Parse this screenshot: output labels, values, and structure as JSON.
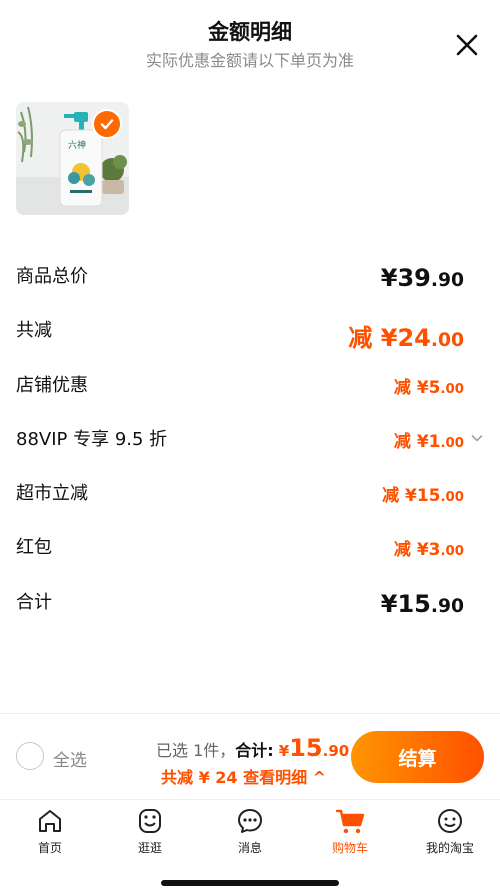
{
  "header": {
    "title": "金额明细",
    "subtitle": "实际优惠金额请以下单页为准"
  },
  "product": {
    "image_alt": "商品图片",
    "selected": true
  },
  "rows": {
    "total": {
      "label": "商品总价",
      "prefix": "¥",
      "int": "39",
      "dec": ".90"
    },
    "discount_total": {
      "label": "共减",
      "prefix": "减 ¥",
      "int": "24",
      "dec": ".00"
    },
    "shop": {
      "label": "店铺优惠",
      "prefix": "减 ¥",
      "int": "5",
      "dec": ".00"
    },
    "vip": {
      "label": "88VIP 专享 9.5 折",
      "prefix": "减 ¥",
      "int": "1",
      "dec": ".00"
    },
    "market": {
      "label": "超市立减",
      "prefix": "减 ¥",
      "int": "15",
      "dec": ".00"
    },
    "redpacket": {
      "label": "红包",
      "prefix": "减 ¥",
      "int": "3",
      "dec": ".00"
    },
    "sum": {
      "label": "合计",
      "prefix": "¥",
      "int": "15",
      "dec": ".90"
    }
  },
  "bottom_bar": {
    "select_all": "全选",
    "selected_count": "已选 1件，",
    "sum_label": "合计:",
    "sum_prefix": "¥",
    "sum_int": "15",
    "sum_dec": ".90",
    "discount_info": "共减 ¥ 24  查看明细 ^",
    "checkout": "结算"
  },
  "tabbar": {
    "items": [
      {
        "label": "首页"
      },
      {
        "label": "逛逛"
      },
      {
        "label": "消息"
      },
      {
        "label": "购物车"
      },
      {
        "label": "我的淘宝"
      }
    ]
  },
  "colors": {
    "accent": "#ff5000",
    "accent_light": "#ff9500",
    "text": "#111111",
    "muted": "#8a8a8a"
  }
}
